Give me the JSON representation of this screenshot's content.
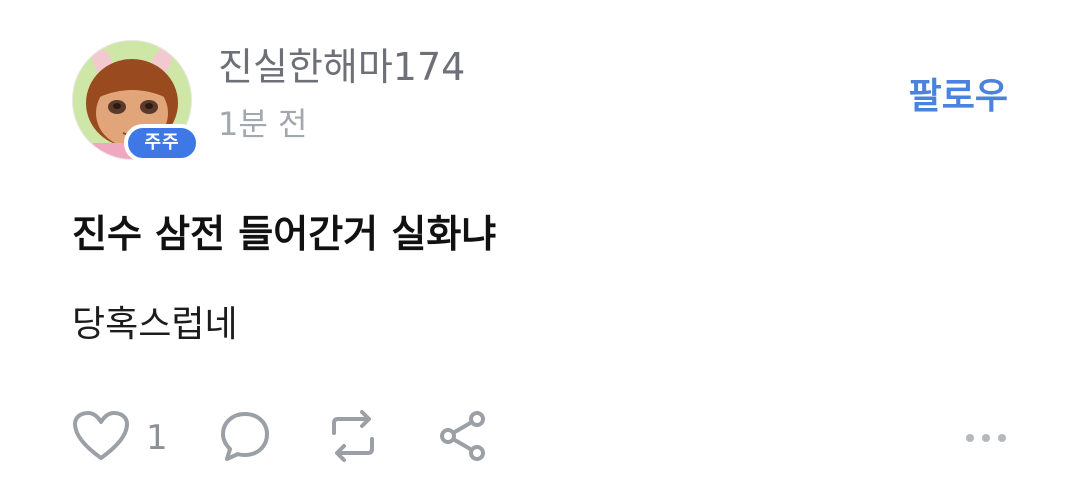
{
  "author": {
    "username": "진실한해마174",
    "badge_label": "주주",
    "timestamp": "1분 전",
    "avatar_icon": "cartoon-girl-avatar"
  },
  "follow_label": "팔로우",
  "post": {
    "title": "진수 삼전 들어간거 실화냐",
    "body": "당혹스럽네"
  },
  "actions": {
    "like_count": "1",
    "icons": [
      "heart-icon",
      "comment-icon",
      "repost-icon",
      "share-icon",
      "more-icon"
    ]
  },
  "colors": {
    "accent": "#4a83dd",
    "badge": "#3d78e6",
    "muted_text": "#a3a8ae",
    "username_text": "#6d7177",
    "icon_gray": "#9aa0a6"
  }
}
